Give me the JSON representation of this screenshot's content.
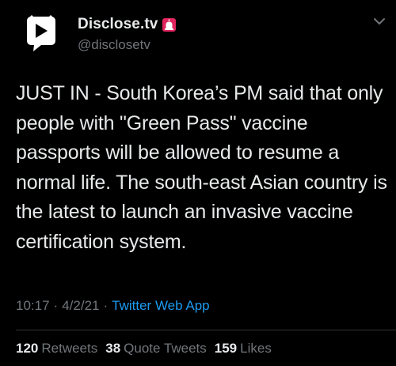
{
  "tweet": {
    "author": {
      "display_name": "Disclose.tv",
      "handle": "@disclosetv",
      "badge_icon": "siren-icon",
      "avatar_icon": "disclose-tv-logo-icon"
    },
    "menu_icon": "chevron-down-icon",
    "text": "JUST IN - South Korea’s PM said that only people with \"Green Pass\" vaccine passports will be allowed to resume a normal life. The south-east Asian country is the latest to launch an invasive vaccine certification system.",
    "time": "10:17",
    "separator": "·",
    "date": "4/2/21",
    "source": "Twitter Web App",
    "stats": {
      "retweets_count": "120",
      "retweets_label": "Retweets",
      "quote_tweets_count": "38",
      "quote_tweets_label": "Quote Tweets",
      "likes_count": "159",
      "likes_label": "Likes"
    }
  },
  "colors": {
    "background": "#000000",
    "primary_text": "#e7e9ea",
    "secondary_text": "#71767b",
    "link": "#1d9bf0",
    "divider": "#2f3336",
    "badge_red": "#e0245e"
  }
}
